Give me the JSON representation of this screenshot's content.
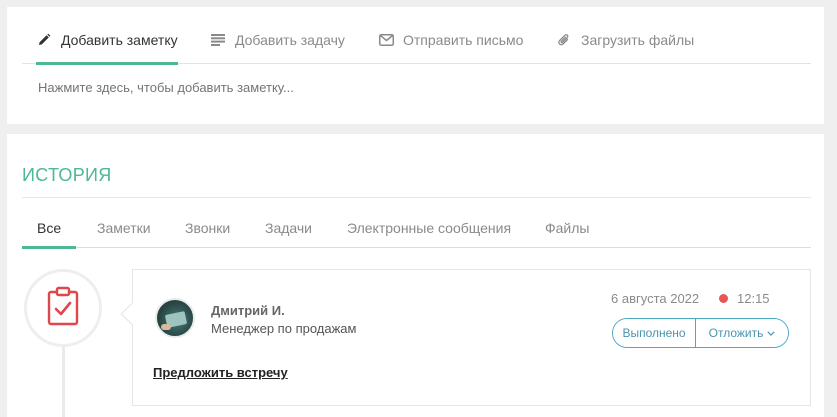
{
  "note_panel": {
    "tabs": [
      {
        "label": "Добавить заметку",
        "icon": "pencil-icon",
        "active": true
      },
      {
        "label": "Добавить задачу",
        "icon": "list-icon",
        "active": false
      },
      {
        "label": "Отправить письмо",
        "icon": "envelope-icon",
        "active": false
      },
      {
        "label": "Загрузить файлы",
        "icon": "paperclip-icon",
        "active": false
      }
    ],
    "placeholder": "Нажмите здесь, чтобы добавить заметку..."
  },
  "history": {
    "title": "ИСТОРИЯ",
    "tabs": [
      {
        "label": "Все",
        "active": true
      },
      {
        "label": "Заметки",
        "active": false
      },
      {
        "label": "Звонки",
        "active": false
      },
      {
        "label": "Задачи",
        "active": false
      },
      {
        "label": "Электронные сообщения",
        "active": false
      },
      {
        "label": "Файлы",
        "active": false
      }
    ],
    "entry": {
      "type_icon": "clipboard-check-icon",
      "author_name": "Дмитрий И.",
      "author_role": "Менеджер по продажам",
      "date": "6 августа 2022",
      "time": "12:15",
      "status_color": "#e85656",
      "done_label": "Выполнено",
      "postpone_label": "Отложить",
      "link_text": "Предложить встречу"
    }
  },
  "colors": {
    "accent": "#4db891",
    "button": "#4aaac0",
    "icon_red": "#e0474c"
  }
}
